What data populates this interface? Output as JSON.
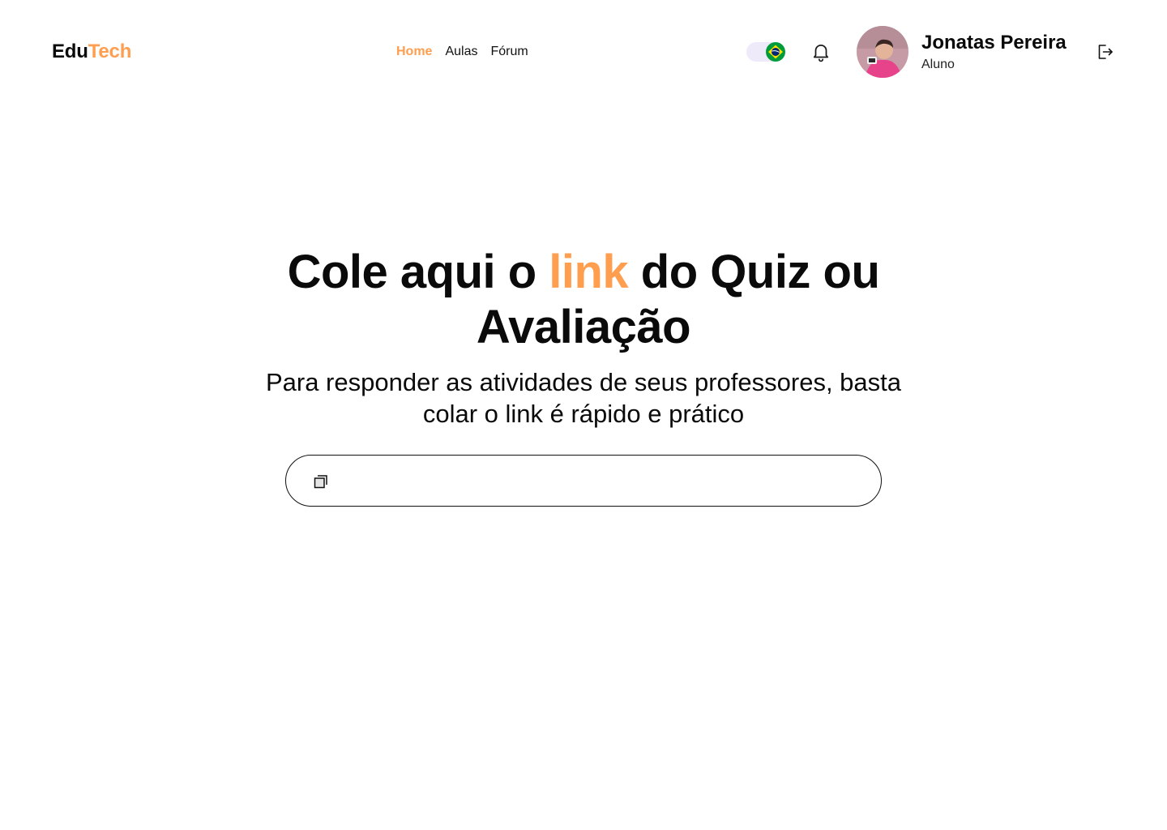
{
  "brand": {
    "logo_part1": "Edu",
    "logo_part2": "Tech",
    "accent_color": "#FF9E4F"
  },
  "nav": {
    "items": [
      {
        "label": "Home",
        "active": true
      },
      {
        "label": "Aulas",
        "active": false
      },
      {
        "label": "Fórum",
        "active": false
      }
    ]
  },
  "header": {
    "language_flag": "brazil-flag-icon",
    "notifications_icon": "bell-icon",
    "logout_icon": "logout-icon"
  },
  "user": {
    "name": "Jonatas Pereira",
    "role": "Aluno"
  },
  "hero": {
    "title_before": "Cole aqui o ",
    "title_highlight": "link",
    "title_after": " do Quiz ou Avaliação",
    "subtitle": "Para responder as atividades de seus professores, basta colar o link é rápido e prático"
  },
  "link_input": {
    "value": "",
    "placeholder": "",
    "icon": "paste-icon"
  }
}
